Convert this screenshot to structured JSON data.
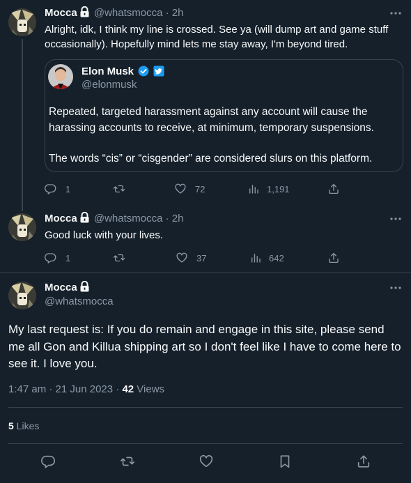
{
  "tweets": [
    {
      "name": "Mocca",
      "handle": "@whatsmocca",
      "sep": " · ",
      "time": "2h",
      "text": "Alright, idk, I think my line is crossed. See ya (will dump art and game stuff occasionally). Hopefully mind lets me stay away, I'm beyond tired.",
      "quote": {
        "name": "Elon Musk",
        "handle": "@elonmusk",
        "text1": "Repeated, targeted harassment against any account will cause the harassing accounts to receive, at minimum, temporary suspensions.",
        "text2": "The words “cis” or “cisgender” are considered slurs on this platform."
      },
      "replies": "1",
      "retweets": "",
      "likes": "72",
      "views": "1,191"
    },
    {
      "name": "Mocca",
      "handle": "@whatsmocca",
      "sep": " · ",
      "time": "2h",
      "text": "Good luck with your lives.",
      "replies": "1",
      "retweets": "",
      "likes": "37",
      "views": "642"
    }
  ],
  "main": {
    "name": "Mocca",
    "handle": "@whatsmocca",
    "text": "My last request is: If you do remain and engage in this site, please send me all Gon and Killua shipping art so I don't feel like I have to come here to see it. I love you.",
    "timestamp": "1:47 am · 21 Jun 2023 · ",
    "views_count": "42",
    "views_label": " Views",
    "likes_count": "5",
    "likes_label": " Likes"
  },
  "colors": {
    "background": "#15202b",
    "border": "#38444d",
    "muted": "#8b98a5",
    "text": "#f7f9f9",
    "verified": "#1d9bf0"
  },
  "icons": [
    "lock-icon",
    "more-icon",
    "verified-badge-icon",
    "twitter-affiliate-icon",
    "reply-icon",
    "retweet-icon",
    "like-icon",
    "views-icon",
    "share-icon",
    "bookmark-icon"
  ]
}
